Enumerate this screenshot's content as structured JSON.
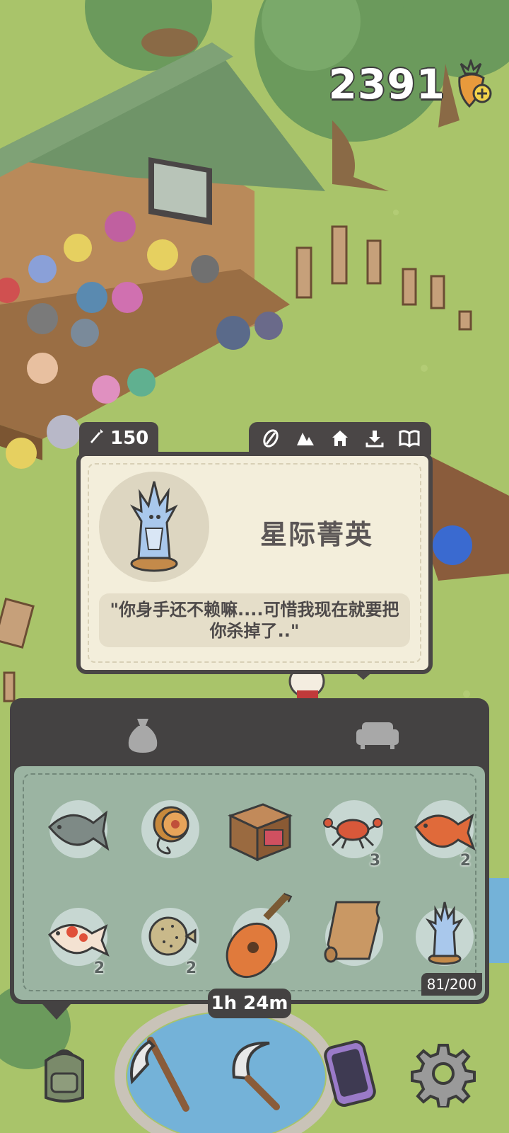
{
  "hud": {
    "currency_amount": "2391",
    "currency_icon": "carrot-plus-icon"
  },
  "item_card": {
    "price_icon": "carrot-icon",
    "price": "150",
    "tab_icons": [
      "leaf-icon",
      "mountain-icon",
      "home-icon",
      "download-icon",
      "book-icon"
    ],
    "name": "星际菁英",
    "quote": "\"你身手还不赖嘛....可惜我现在就要把你杀掉了..\"",
    "portrait_icon": "crystal-figure-icon"
  },
  "inventory": {
    "tabs": [
      {
        "icon": "bag-icon"
      },
      {
        "icon": "sofa-icon"
      }
    ],
    "items": [
      {
        "icon": "fish-icon",
        "count": ""
      },
      {
        "icon": "spool-icon",
        "count": ""
      },
      {
        "icon": "crate-icon",
        "count": ""
      },
      {
        "icon": "crab-icon",
        "count": "3"
      },
      {
        "icon": "red-fish-icon",
        "count": "2"
      },
      {
        "icon": "koi-icon",
        "count": "2"
      },
      {
        "icon": "pufferfish-icon",
        "count": "2"
      },
      {
        "icon": "lute-icon",
        "count": ""
      },
      {
        "icon": "scroll-icon",
        "count": ""
      },
      {
        "icon": "crystal-figure-icon",
        "count": ""
      }
    ],
    "capacity": "81/200"
  },
  "timer": "1h 24m",
  "toolbar": [
    "backpack-icon",
    "axe-icon",
    "sickle-icon",
    "phone-icon",
    "gear-icon"
  ],
  "colors": {
    "panel_dark": "#444242",
    "card_bg": "#f3eedb",
    "grid_bg": "#9bb4a2",
    "grass": "#a9c46a"
  }
}
